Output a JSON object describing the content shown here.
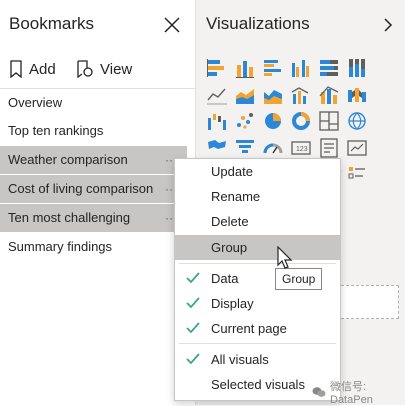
{
  "bookmarks": {
    "title": "Bookmarks",
    "add_label": "Add",
    "view_label": "View",
    "items": [
      {
        "label": "Overview"
      },
      {
        "label": "Top ten rankings"
      },
      {
        "label": "Weather comparison"
      },
      {
        "label": "Cost of living comparison"
      },
      {
        "label": "Ten most challenging"
      },
      {
        "label": "Summary findings"
      }
    ],
    "item_dots": "···"
  },
  "visualizations": {
    "title": "Visualizations"
  },
  "context_menu": {
    "update": "Update",
    "rename": "Rename",
    "delete": "Delete",
    "group": "Group",
    "data": "Data",
    "display": "Display",
    "current_page": "Current page",
    "all_visuals": "All visuals",
    "selected_visuals": "Selected visuals"
  },
  "tooltip": "Group",
  "watermark": "微信号: DataPen",
  "colors": {
    "accent_teal": "#3aa58c",
    "selection_gray": "#c8c6c4",
    "pane_bg": "#f3f2f1"
  }
}
